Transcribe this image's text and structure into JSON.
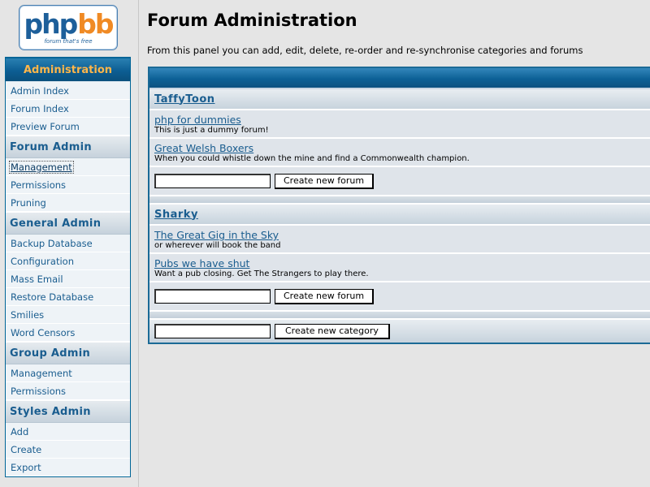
{
  "logo": {
    "word_php": "php",
    "word_bb": "bb",
    "tagline": "forum that's free"
  },
  "nav": {
    "title": "Administration",
    "top_items": [
      "Admin Index",
      "Forum Index",
      "Preview Forum"
    ],
    "sections": [
      {
        "label": "Forum Admin",
        "items": [
          "Management",
          "Permissions",
          "Pruning"
        ]
      },
      {
        "label": "General Admin",
        "items": [
          "Backup Database",
          "Configuration",
          "Mass Email",
          "Restore Database",
          "Smilies",
          "Word Censors"
        ]
      },
      {
        "label": "Group Admin",
        "items": [
          "Management",
          "Permissions"
        ]
      },
      {
        "label": "Styles Admin",
        "items": [
          "Add",
          "Create",
          "Export"
        ]
      }
    ]
  },
  "main": {
    "title": "Forum Administration",
    "intro": "From this panel you can add, edit, delete, re-order and re-synchronise categories and forums",
    "categories": [
      {
        "name": "TaffyToon",
        "forums": [
          {
            "name": "php for dummies",
            "desc": "This is just a dummy forum!"
          },
          {
            "name": "Great Welsh Boxers",
            "desc": "When you could whistle down the mine and find a Commonwealth champion."
          }
        ],
        "create_forum_label": "Create new forum"
      },
      {
        "name": "Sharky",
        "forums": [
          {
            "name": "The Great Gig in the Sky",
            "desc": "or wherever will book the band"
          },
          {
            "name": "Pubs we have shut",
            "desc": "Want a pub closing. Get The Strangers to play there."
          }
        ],
        "create_forum_label": "Create new forum"
      }
    ],
    "create_category_label": "Create new category"
  },
  "colors": {
    "accent": "#1a5d8f",
    "header": "#0d6196",
    "highlight": "#ffb64a"
  }
}
